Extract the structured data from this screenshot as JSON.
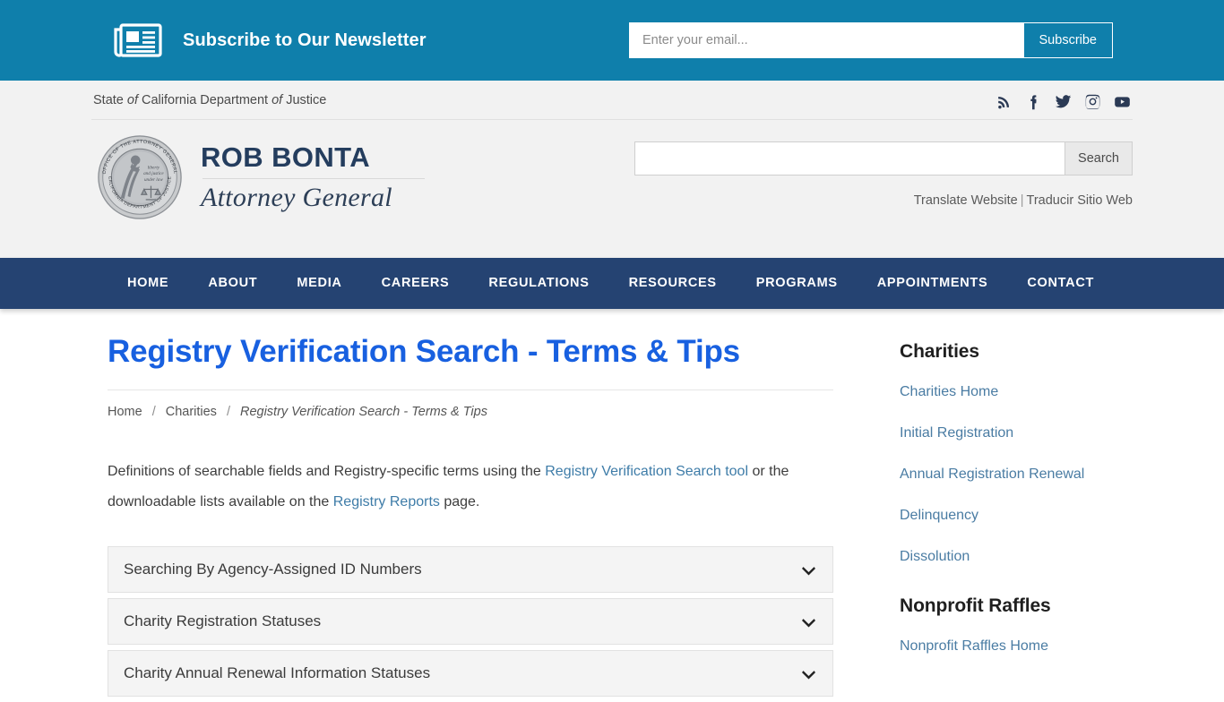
{
  "newsletter": {
    "icon": "newspaper-icon",
    "title": "Subscribe to Our Newsletter",
    "email_placeholder": "Enter your email...",
    "email_value": "",
    "subscribe_label": "Subscribe",
    "bar_color": "#0f7fab"
  },
  "header": {
    "agency_pre": "State ",
    "agency_of1": "of",
    "agency_mid": " California Department ",
    "agency_of2": "of",
    "agency_post": " Justice",
    "social": [
      {
        "name": "rss-icon",
        "label": "RSS"
      },
      {
        "name": "facebook-icon",
        "label": "Facebook"
      },
      {
        "name": "twitter-icon",
        "label": "Twitter"
      },
      {
        "name": "instagram-icon",
        "label": "Instagram"
      },
      {
        "name": "youtube-icon",
        "label": "YouTube"
      }
    ],
    "seal": {
      "outer_top_text": "OFFICE OF THE ATTORNEY GENERAL",
      "outer_bottom_text": "CALIFORNIA DEPARTMENT OF JUSTICE",
      "inner_text": "liberty and justice under law"
    },
    "ag_name": "ROB BONTA",
    "ag_title": "Attorney General",
    "search_value": "",
    "search_placeholder": "",
    "search_button": "Search",
    "translate_en": "Translate Website",
    "translate_sep": "|",
    "translate_es": "Traducir Sitio Web"
  },
  "nav": {
    "bar_color": "#254372",
    "items": [
      {
        "label": "HOME"
      },
      {
        "label": "ABOUT"
      },
      {
        "label": "MEDIA"
      },
      {
        "label": "CAREERS"
      },
      {
        "label": "REGULATIONS"
      },
      {
        "label": "RESOURCES"
      },
      {
        "label": "PROGRAMS"
      },
      {
        "label": "APPOINTMENTS"
      },
      {
        "label": "CONTACT"
      }
    ]
  },
  "main": {
    "page_title": "Registry Verification Search - Terms & Tips",
    "title_color": "#1860e0",
    "breadcrumb": {
      "home": "Home",
      "section": "Charities",
      "current": "Registry Verification Search - Terms & Tips",
      "separator": "/"
    },
    "intro": {
      "part1": "Definitions of searchable fields and Registry-specific terms using the ",
      "link1": "Registry Verification Search tool",
      "part2": " or the downloadable lists available on the ",
      "link2": "Registry Reports",
      "part3": " page."
    },
    "accordion": [
      {
        "label": "Searching By Agency-Assigned ID Numbers",
        "icon": "chevron-down-icon"
      },
      {
        "label": "Charity Registration Statuses",
        "icon": "chevron-down-icon"
      },
      {
        "label": "Charity Annual Renewal Information Statuses",
        "icon": "chevron-down-icon"
      }
    ]
  },
  "sidebar": {
    "sections": [
      {
        "heading": "Charities",
        "links": [
          {
            "label": "Charities Home"
          },
          {
            "label": "Initial Registration"
          },
          {
            "label": "Annual Registration Renewal"
          },
          {
            "label": "Delinquency"
          },
          {
            "label": "Dissolution"
          }
        ]
      },
      {
        "heading": "Nonprofit Raffles",
        "links": [
          {
            "label": "Nonprofit Raffles Home"
          }
        ]
      }
    ],
    "link_color": "#4a7ca3"
  }
}
